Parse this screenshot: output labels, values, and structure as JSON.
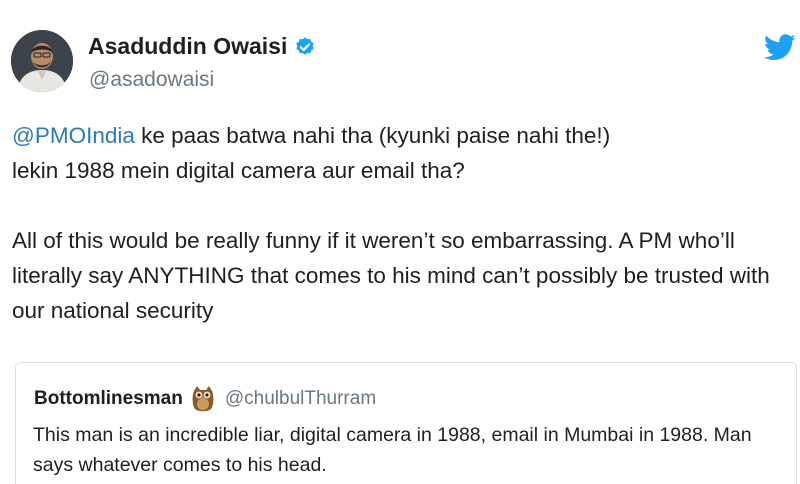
{
  "author": {
    "display_name": "Asaduddin Owaisi",
    "handle": "@asadowaisi",
    "avatar_icon": "profile-photo",
    "verified_icon": "verified-badge-icon"
  },
  "brand": {
    "icon": "twitter-bird-icon",
    "color": "#1da1f2"
  },
  "tweet": {
    "mention": "@PMOIndia",
    "line1_rest": " ke paas batwa nahi tha (kyunki paise nahi the!)",
    "line2": "lekin 1988 mein digital camera aur email tha?",
    "paragraph2": "All of this would be really funny if it weren’t so embarrassing. A PM who’ll literally say ANYTHING that comes to his mind can’t possibly be trusted with our national security"
  },
  "quoted_tweet": {
    "display_name": "Bottomlinesman",
    "emoji_icon": "owl-icon",
    "handle": "@chulbulThurram",
    "text": "This man is an incredible liar, digital camera in 1988, email in Mumbai in 1988. Man says whatever comes to his head."
  },
  "colors": {
    "link": "#2b7bb9",
    "secondary_text": "#697882",
    "verified": "#1da1f2"
  }
}
